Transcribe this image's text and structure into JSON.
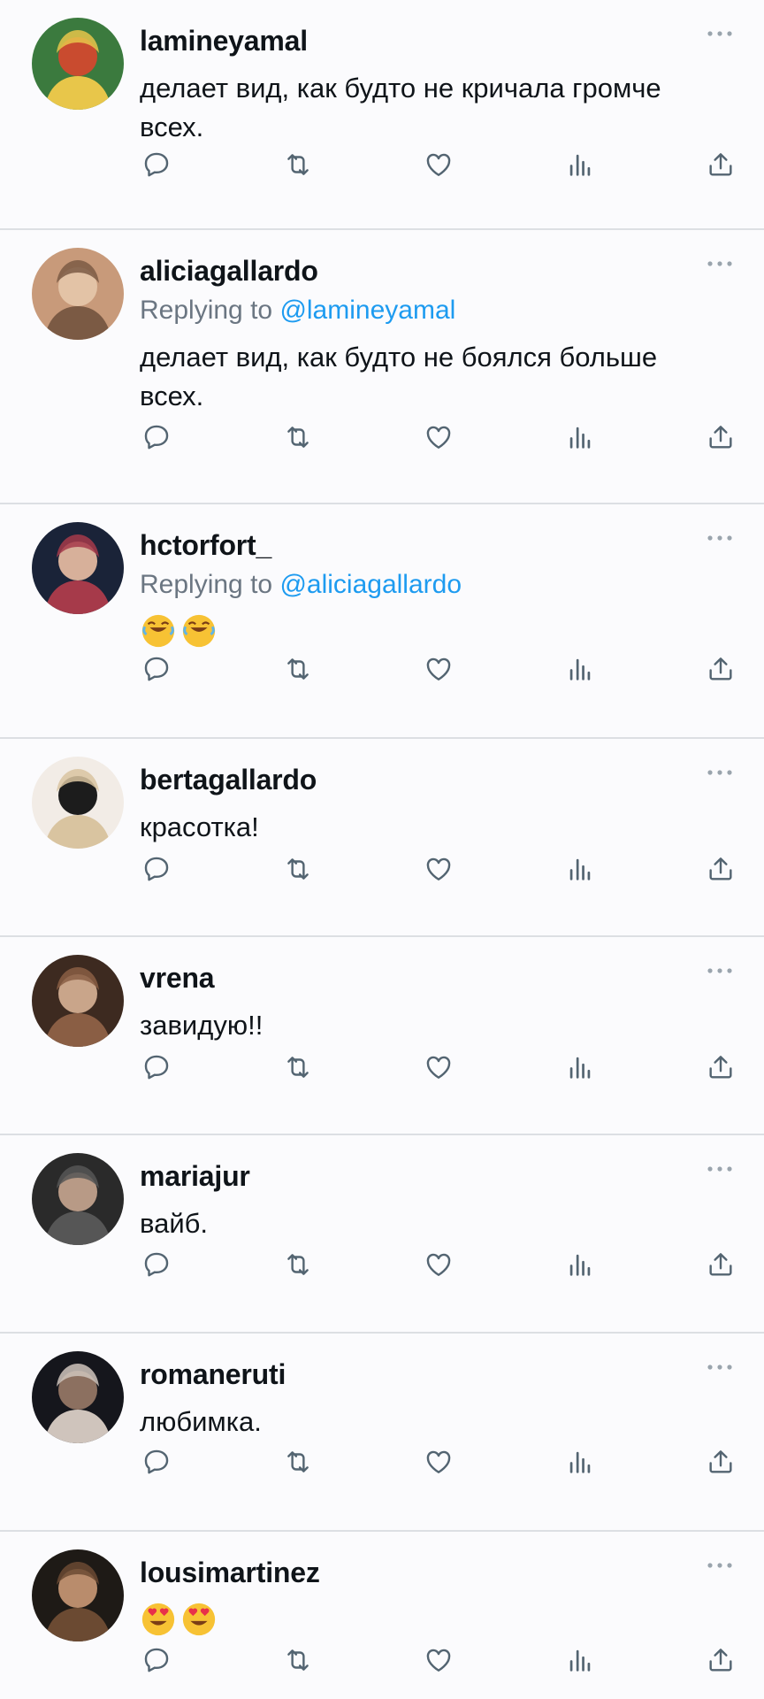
{
  "replies_prefix": "Replying to",
  "tweets": [
    {
      "username": "lamineyamal",
      "reply_to": "",
      "text": "делает вид, как будто не кричала громче всех.",
      "emoji": [],
      "avatar_colors": [
        "#3b7a3e",
        "#e8c64a",
        "#c94b2f"
      ]
    },
    {
      "username": "aliciagallardo",
      "reply_to": "@lamineyamal",
      "text": "делает вид, как будто не боялся больше всех.",
      "emoji": [],
      "avatar_colors": [
        "#c89a7a",
        "#7b5a44",
        "#e3c3a6"
      ]
    },
    {
      "username": "hctorfort_",
      "reply_to": "@aliciagallardo",
      "text": "",
      "emoji": [
        "😂",
        "😂"
      ],
      "avatar_colors": [
        "#1a2338",
        "#a63a4a",
        "#d7b09a"
      ]
    },
    {
      "username": "bertagallardo",
      "reply_to": "",
      "text": "красотка!",
      "emoji": [],
      "avatar_colors": [
        "#f2ece6",
        "#d9c4a0",
        "#1c1c1c"
      ]
    },
    {
      "username": "vrena",
      "reply_to": "",
      "text": "завидую!!",
      "emoji": [],
      "avatar_colors": [
        "#3d2a20",
        "#8a5e44",
        "#c9a58a"
      ]
    },
    {
      "username": "mariajur",
      "reply_to": "",
      "text": "вайб.",
      "emoji": [],
      "avatar_colors": [
        "#2a2a2a",
        "#565656",
        "#b89a86"
      ]
    },
    {
      "username": "romaneruti",
      "reply_to": "",
      "text": "любимка.",
      "emoji": [],
      "avatar_colors": [
        "#15161c",
        "#cfc4bc",
        "#8c7060"
      ]
    },
    {
      "username": "lousimartinez",
      "reply_to": "",
      "text": "",
      "emoji": [
        "😍",
        "😍"
      ],
      "avatar_colors": [
        "#1e1a16",
        "#6b4a32",
        "#b98c6c"
      ]
    }
  ],
  "icons": {
    "reply": "reply-icon",
    "retweet": "retweet-icon",
    "like": "heart-icon",
    "views": "views-icon",
    "share": "share-icon",
    "more": "more-icon"
  },
  "colors": {
    "link": "#1d9bf0",
    "secondary_text": "#6b7682",
    "icon": "#536471",
    "divider": "#dcdfe3"
  }
}
